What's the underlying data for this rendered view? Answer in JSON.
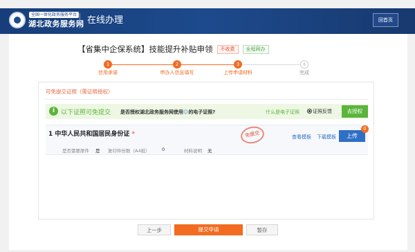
{
  "header": {
    "logo_subtitle": "全国一体化政务服务平台",
    "logo_title": "湖北政务服务网",
    "section_title": "在线办理",
    "home_label": "回首页"
  },
  "page": {
    "title": "【省集中企保系统】技能提升补贴申领",
    "tag_fee": "不收费",
    "tag_online": "全程网办"
  },
  "steps": [
    {
      "number": "1",
      "label": "信用承诺",
      "state": "done"
    },
    {
      "number": "2",
      "label": "申办人信息填写",
      "state": "done"
    },
    {
      "number": "3",
      "label": "上传申请材料",
      "state": "current"
    },
    {
      "number": "4",
      "label": "完成",
      "state": "pending"
    }
  ],
  "panel": {
    "title": "可免提交证照（需证照授权）",
    "banner": {
      "icon": "i",
      "main_text": "以下证照可免提交",
      "question_prefix": "是否授权湖北政务服务网使用",
      "question_suffix": "的电子证照?",
      "link_text": "什么是电子证照",
      "feedback_text": "证照反馈",
      "auth_button": "去授权"
    },
    "item": {
      "title": "1  中华人民共和国居民身份证",
      "required_mark": "*",
      "stamp_text": "免提交",
      "view_template": "查看模板",
      "download_template": "下载模板",
      "upload_label": "上传",
      "upload_count": "0",
      "meta_required_label": "是否需要原件",
      "meta_required_value": "是",
      "meta_copies_label": "复印件份数（A4纸）",
      "meta_copies_value": "0",
      "meta_desc_label": "材料说明",
      "meta_desc_value": "无"
    }
  },
  "footer": {
    "prev_label": "上一步",
    "submit_label": "提交申请",
    "save_label": "暂存"
  },
  "colors": {
    "header_blue": "#1d4a8c",
    "accent_orange": "#f26b21",
    "success_green": "#5ab53a",
    "link_blue": "#2f6fc6"
  }
}
